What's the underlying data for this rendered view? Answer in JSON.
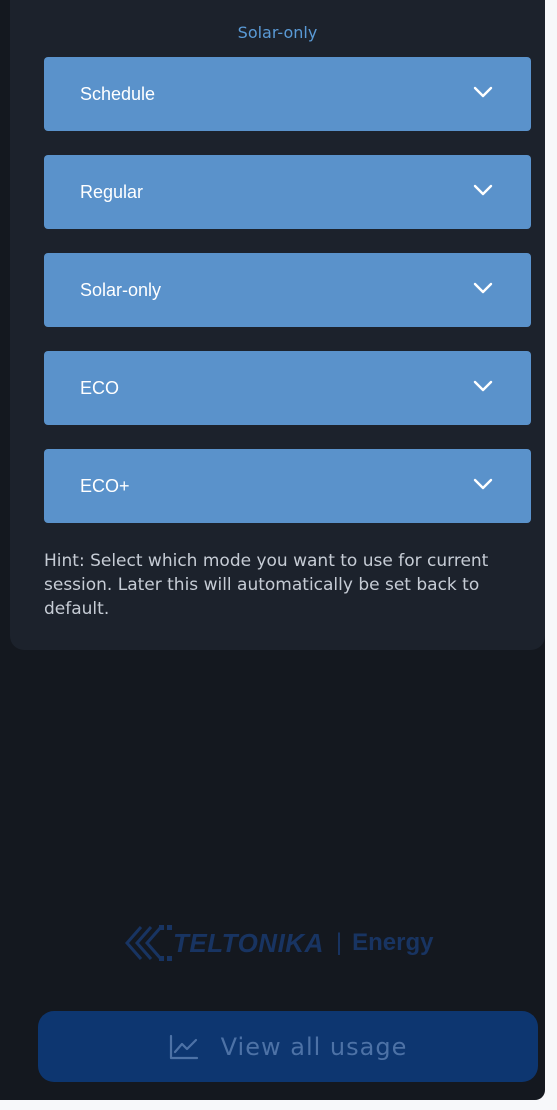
{
  "panel": {
    "title": "Solar-only",
    "modes": [
      {
        "label": "Schedule"
      },
      {
        "label": "Regular"
      },
      {
        "label": "Solar-only"
      },
      {
        "label": "ECO"
      },
      {
        "label": "ECO+"
      }
    ],
    "hint": "Hint: Select which mode you want to use for current session. Later this will automatically be set back to default."
  },
  "brand": {
    "name": "TELTONIKA",
    "separator": "|",
    "suffix": "Energy"
  },
  "usage_button": {
    "label": "View all usage",
    "icon": "line-chart-icon"
  },
  "colors": {
    "background": "#14181f",
    "panel": "#1c222c",
    "accent": "#5a9ad6",
    "mode_button": "#5a92cb",
    "primary_button": "#0d3670"
  }
}
